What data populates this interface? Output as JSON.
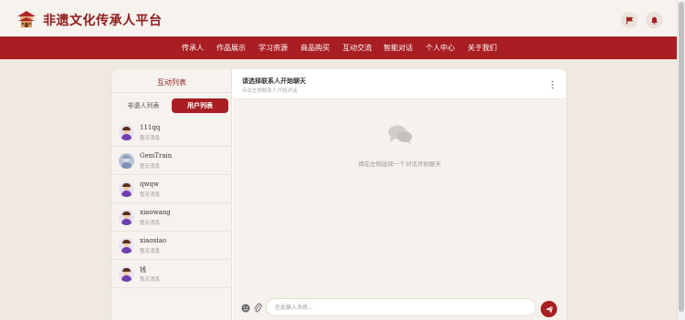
{
  "header": {
    "site_title": "非遗文化传承人平台"
  },
  "nav": {
    "items": [
      "传承人",
      "作品展示",
      "学习资源",
      "商品购买",
      "互动交流",
      "智能对话",
      "个人中心",
      "关于我们"
    ]
  },
  "sidebar": {
    "title": "互动列表",
    "tabs": [
      {
        "label": "非遗人列表",
        "active": false
      },
      {
        "label": "用户列表",
        "active": true
      }
    ],
    "users": [
      {
        "name": "111qq",
        "last_message": "暂无消息",
        "avatar": "cartoon-avatar"
      },
      {
        "name": "GemTrain",
        "last_message": "暂无消息",
        "avatar": "photo-avatar"
      },
      {
        "name": "qwqw",
        "last_message": "暂无消息",
        "avatar": "cartoon-avatar"
      },
      {
        "name": "xiaowang",
        "last_message": "暂无消息",
        "avatar": "cartoon-avatar"
      },
      {
        "name": "xiaoxiao",
        "last_message": "暂无消息",
        "avatar": "cartoon-avatar"
      },
      {
        "name": "钱",
        "last_message": "暂无消息",
        "avatar": "cartoon-avatar"
      }
    ]
  },
  "chat": {
    "title": "请选择联系人开始聊天",
    "subtitle": "点击左侧联系人开始对话",
    "empty_text": "请在左侧选择一个对话开始聊天",
    "input_placeholder": "在此输入消息..."
  },
  "colors": {
    "brand_red": "#a81e22",
    "title_red": "#8f1d1d",
    "page_bg": "#efe9e2"
  }
}
